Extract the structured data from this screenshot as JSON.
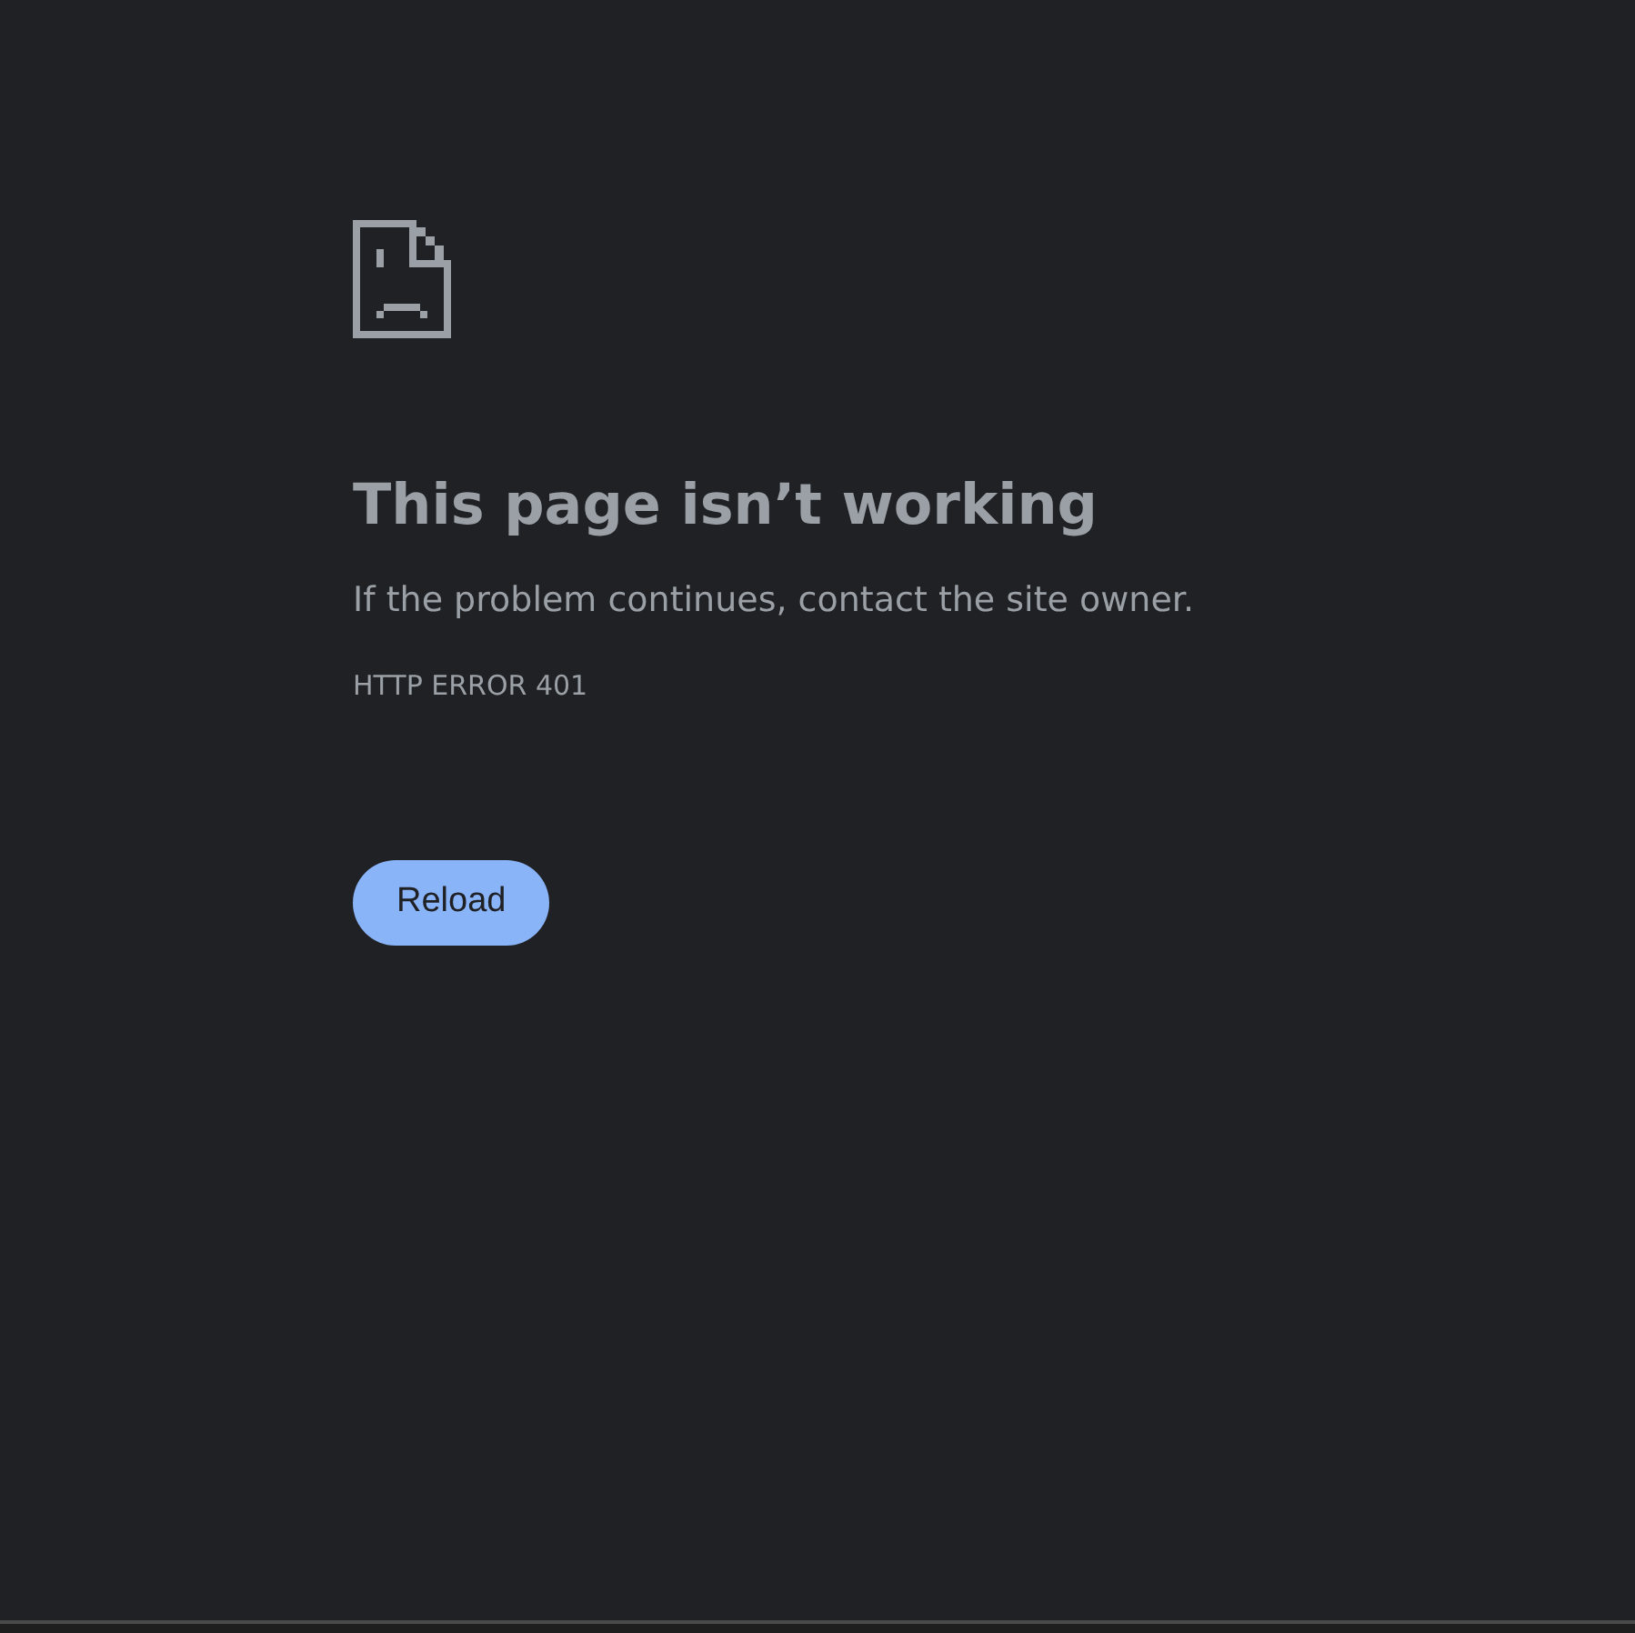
{
  "heading": "This page isn’t working",
  "message": "If the problem continues, contact the site owner.",
  "error_code": "HTTP ERROR 401",
  "button": "Reload"
}
